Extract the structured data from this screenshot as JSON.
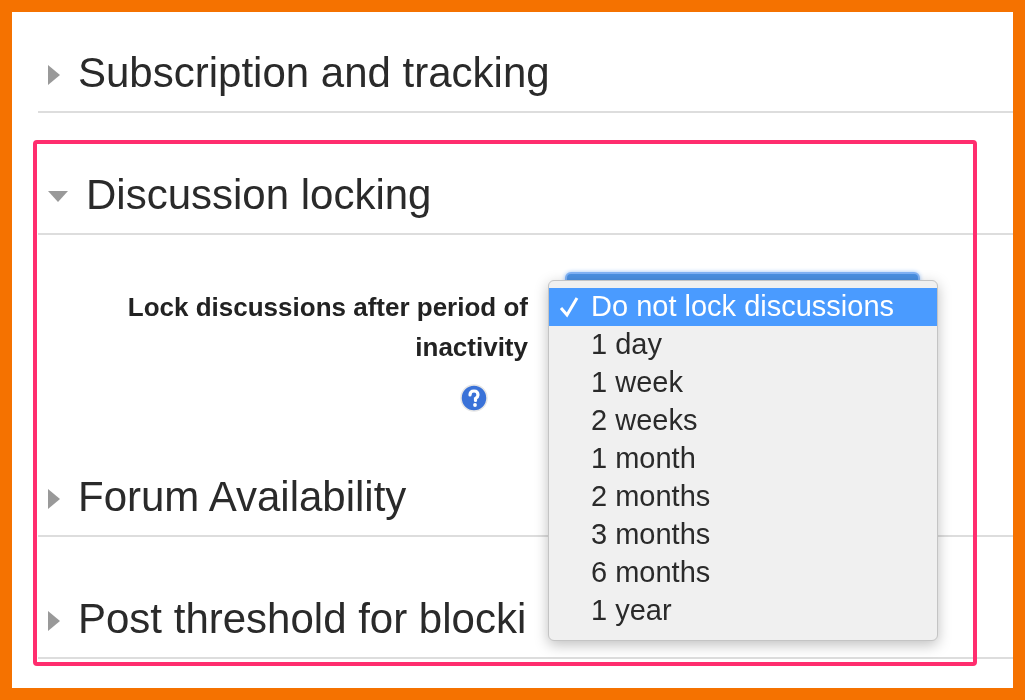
{
  "sections": [
    {
      "title": "Subscription and tracking",
      "expanded": false
    },
    {
      "title": "Discussion locking",
      "expanded": true,
      "field": {
        "label": "Lock discussions after period of inactivity",
        "help": true
      }
    },
    {
      "title": "Forum Availability",
      "expanded": false
    },
    {
      "title": "Post threshold for blocki",
      "expanded": false
    }
  ],
  "dropdown": {
    "options": [
      {
        "label": "Do not lock discussions",
        "selected": true
      },
      {
        "label": "1 day",
        "selected": false
      },
      {
        "label": "1 week",
        "selected": false
      },
      {
        "label": "2 weeks",
        "selected": false
      },
      {
        "label": "1 month",
        "selected": false
      },
      {
        "label": "2 months",
        "selected": false
      },
      {
        "label": "3 months",
        "selected": false
      },
      {
        "label": "6 months",
        "selected": false
      },
      {
        "label": "1 year",
        "selected": false
      }
    ]
  }
}
